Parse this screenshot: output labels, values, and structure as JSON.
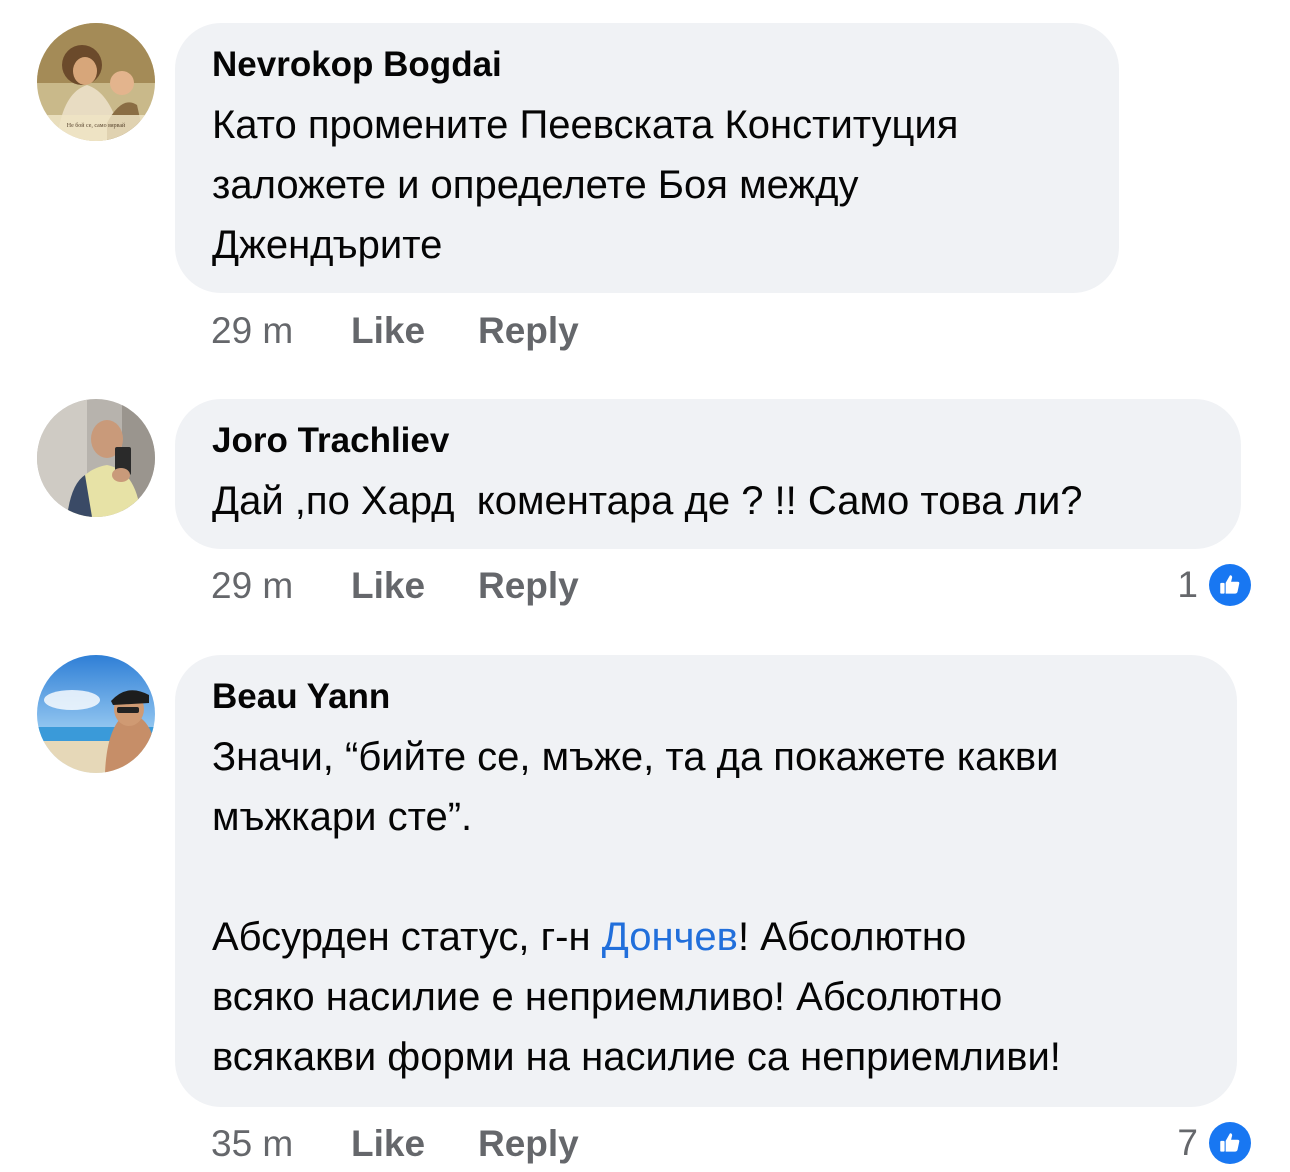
{
  "comments": [
    {
      "author": "Nevrokop Bogdai",
      "avatar": "avatar-painting",
      "lines": [
        "Като промените Пеевската Конституция",
        "заложете и определете Боя между",
        "Джендърите"
      ],
      "time": "29 m",
      "like_label": "Like",
      "reply_label": "Reply",
      "reactions": null
    },
    {
      "author": "Joro Trachliev",
      "avatar": "avatar-selfie",
      "lines": [
        "Дай ,по Хард  коментара де ? !! Само това ли?"
      ],
      "time": "29 m",
      "like_label": "Like",
      "reply_label": "Reply",
      "reactions": {
        "count": "1",
        "icon": "thumbs-up-icon",
        "color": "#1877f2"
      }
    },
    {
      "author": "Beau Yann",
      "avatar": "avatar-beach",
      "lines": [
        "Значи, “бийте се, мъже, та да покажете какви",
        "мъжкари сте”."
      ],
      "lines2_prefix": "Абсурден статус, г-н ",
      "mention": "Дончев",
      "lines2_suffix": "! Абсолютно",
      "lines3": [
        "всяко насилие е неприемливо! Абсолютно",
        "всякакви форми на насилие са неприемливи!"
      ],
      "time": "35 m",
      "like_label": "Like",
      "reply_label": "Reply",
      "reactions": {
        "count": "7",
        "icon": "thumbs-up-icon",
        "color": "#1877f2"
      }
    }
  ],
  "avatar_caption": "Не бой се, само вярвай"
}
